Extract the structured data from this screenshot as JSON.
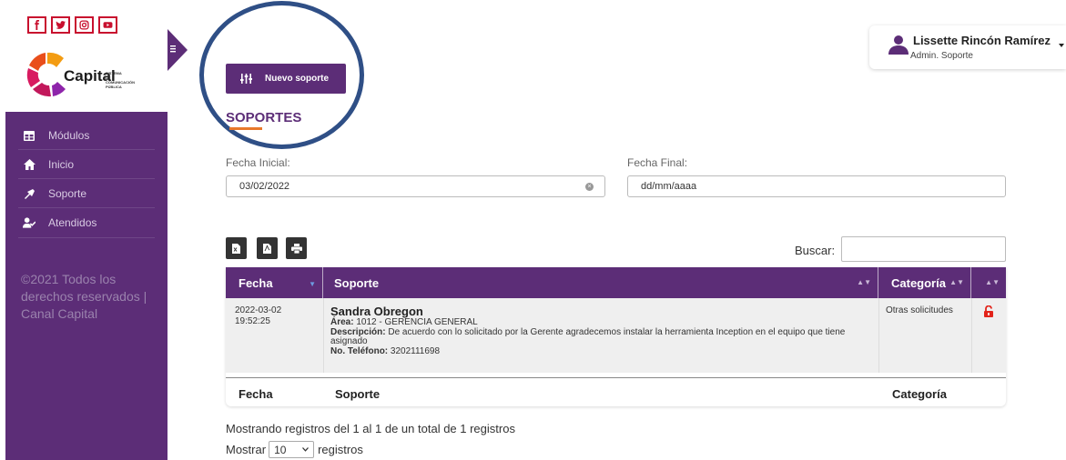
{
  "brand": {
    "logo_text": "Capital",
    "logo_subtext": "SISTEMA DE COMUNICACIÓN PÚBLICA",
    "social_icons": [
      "facebook-icon",
      "twitter-icon",
      "instagram-icon",
      "youtube-icon"
    ],
    "accent_color": "#5c2d77",
    "social_color": "#c8102e"
  },
  "sidebar": {
    "items": [
      {
        "label": "Módulos",
        "icon": "grid-icon"
      },
      {
        "label": "Inicio",
        "icon": "home-icon"
      },
      {
        "label": "Soporte",
        "icon": "support-icon"
      },
      {
        "label": "Atendidos",
        "icon": "user-check-icon"
      }
    ],
    "copyright": "©2021 Todos los derechos reservados | Canal Capital"
  },
  "header": {
    "user_name": "Lissette Rincón Ramírez",
    "user_role": "Admin. Soporte"
  },
  "main": {
    "new_button": "Nuevo soporte",
    "title": "SOPORTES",
    "fecha_inicial_label": "Fecha Inicial:",
    "fecha_inicial_value": "03/02/2022",
    "fecha_final_label": "Fecha Final:",
    "fecha_final_placeholder": "dd/mm/aaaa",
    "search_label": "Buscar:",
    "table": {
      "headers": [
        "Fecha",
        "Soporte",
        "Categoría",
        ""
      ],
      "footers": [
        "Fecha",
        "Soporte",
        "Categoría"
      ],
      "rows": [
        {
          "date": "2022-03-02",
          "time": "19:52:25",
          "name": "Sandra Obregon",
          "area_label": "Área:",
          "area": "1012 - GERENCIA GENERAL",
          "desc_label": "Descripción:",
          "desc": "De acuerdo con lo solicitado por la Gerente agradecemos instalar la herramienta Inception en el equipo que tiene asignado",
          "phone_label": "No. Teléfono:",
          "phone": "3202111698",
          "category": "Otras solicitudes"
        }
      ]
    },
    "info": "Mostrando registros del 1 al 1 de un total de 1 registros",
    "show_label": "Mostrar",
    "show_value": "10",
    "records_label": "registros"
  }
}
